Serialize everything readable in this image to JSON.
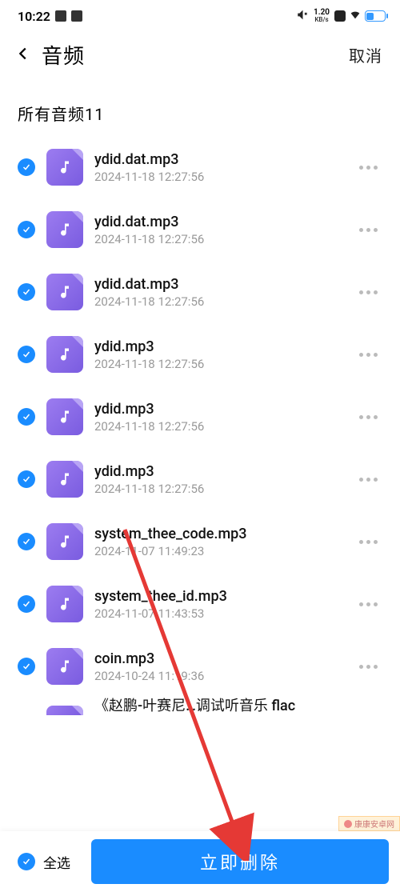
{
  "status": {
    "time": "10:22",
    "net_speed_value": "1.20",
    "net_speed_unit": "KB/s"
  },
  "header": {
    "title": "音频",
    "cancel": "取消"
  },
  "section": {
    "label": "所有音频11"
  },
  "files": [
    {
      "name": "ydid.dat.mp3",
      "ts": "2024-11-18 12:27:56"
    },
    {
      "name": "ydid.dat.mp3",
      "ts": "2024-11-18 12:27:56"
    },
    {
      "name": "ydid.dat.mp3",
      "ts": "2024-11-18 12:27:56"
    },
    {
      "name": "ydid.mp3",
      "ts": "2024-11-18 12:27:56"
    },
    {
      "name": "ydid.mp3",
      "ts": "2024-11-18 12:27:56"
    },
    {
      "name": "ydid.mp3",
      "ts": "2024-11-18 12:27:56"
    },
    {
      "name": "system_thee_code.mp3",
      "ts": "2024-11-07 11:49:23"
    },
    {
      "name": "system_thee_id.mp3",
      "ts": "2024-11-07 11:43:53"
    },
    {
      "name": "coin.mp3",
      "ts": "2024-10-24 11:19:36"
    }
  ],
  "truncated_file": {
    "name": "《赵鹏-叶赛尼…调试听音乐 flac"
  },
  "bottom": {
    "select_all": "全选",
    "delete": "立即删除"
  },
  "watermark": "康康安卓网",
  "colors": {
    "accent": "#1a8cff",
    "audio_icon": "#7a5ce0"
  }
}
